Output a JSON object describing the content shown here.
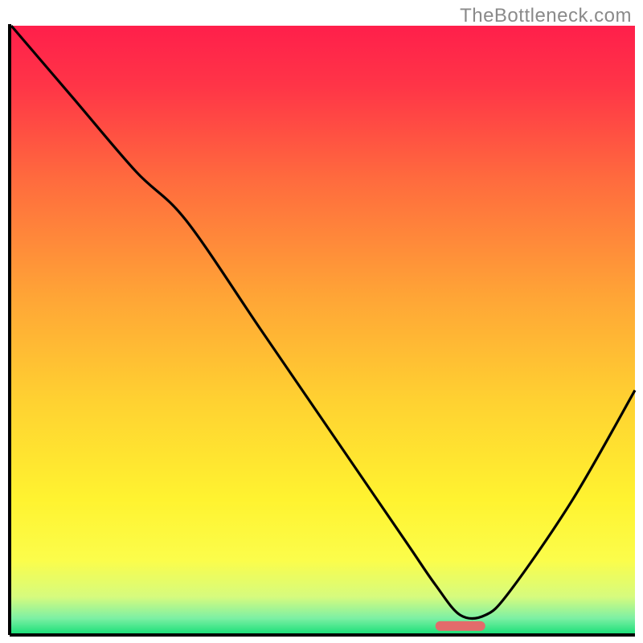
{
  "watermark": "TheBottleneck.com",
  "chart_data": {
    "type": "line",
    "title": "",
    "xlabel": "",
    "ylabel": "",
    "xlim": [
      0,
      100
    ],
    "ylim": [
      0,
      100
    ],
    "grid": false,
    "background": {
      "type": "vertical-gradient",
      "stops": [
        {
          "offset": 0.0,
          "color": "#ff1f4b"
        },
        {
          "offset": 0.1,
          "color": "#ff3547"
        },
        {
          "offset": 0.25,
          "color": "#ff6a3e"
        },
        {
          "offset": 0.45,
          "color": "#ffa636"
        },
        {
          "offset": 0.62,
          "color": "#ffd231"
        },
        {
          "offset": 0.78,
          "color": "#fff330"
        },
        {
          "offset": 0.88,
          "color": "#fbfd4b"
        },
        {
          "offset": 0.94,
          "color": "#d6fb7e"
        },
        {
          "offset": 0.975,
          "color": "#7df0a4"
        },
        {
          "offset": 1.0,
          "color": "#1fe07a"
        }
      ]
    },
    "series": [
      {
        "name": "bottleneck-curve",
        "color": "#000000",
        "x": [
          0,
          10,
          20,
          28,
          40,
          50,
          58,
          64,
          68,
          72,
          76,
          80,
          90,
          100
        ],
        "y": [
          100,
          88,
          76,
          68,
          50,
          35,
          23,
          14,
          8,
          3,
          3,
          7,
          22,
          40
        ]
      }
    ],
    "marker": {
      "name": "optimal-zone",
      "color": "#e36b6b",
      "x_start": 68,
      "x_end": 76,
      "y": 1.2
    }
  }
}
